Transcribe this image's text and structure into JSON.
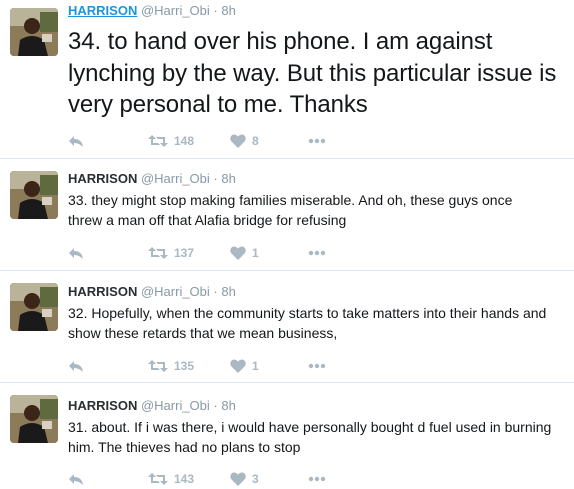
{
  "tweets": [
    {
      "name": "HARRISON",
      "handle": "@Harri_Obi",
      "separator": "·",
      "time": "8h",
      "text": "34. to hand over his phone. I am against lynching by the way. But this particular issue is very personal to me. Thanks",
      "retweets": "148",
      "likes": "8"
    },
    {
      "name": "HARRISON",
      "handle": "@Harri_Obi",
      "separator": "·",
      "time": "8h",
      "text": "33. they might stop making families miserable. And oh, these guys once threw a man off that Alafia bridge for refusing",
      "retweets": "137",
      "likes": "1"
    },
    {
      "name": "HARRISON",
      "handle": "@Harri_Obi",
      "separator": "·",
      "time": "8h",
      "text": "32. Hopefully, when the community starts to take matters into their hands and show these retards that we mean business,",
      "retweets": "135",
      "likes": "1"
    },
    {
      "name": "HARRISON",
      "handle": "@Harri_Obi",
      "separator": "·",
      "time": "8h",
      "text": "31. about. If i was there, i would have personally bought d fuel used in burning him. The thieves had no plans to stop",
      "retweets": "143",
      "likes": "3"
    }
  ],
  "icons": {
    "reply": "reply-icon",
    "retweet": "retweet-icon",
    "like": "heart-icon",
    "more": "more-icon"
  },
  "colors": {
    "link": "#1b95e0",
    "muted": "#8899a6",
    "icon": "#aab8c2",
    "divider": "#e1e8ed"
  }
}
